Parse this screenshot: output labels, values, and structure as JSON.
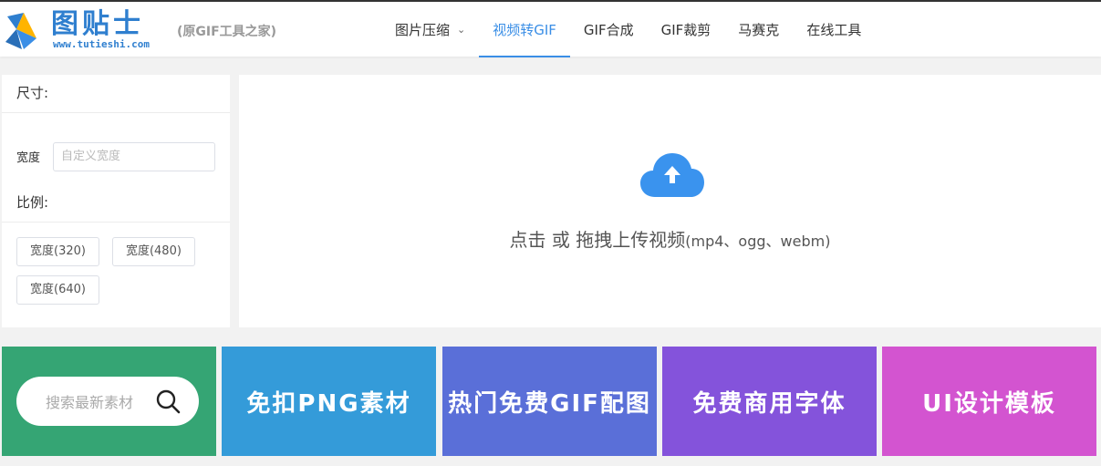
{
  "header": {
    "logo_name": "图贴士",
    "logo_url": "www.tutieshi.com",
    "logo_sub": "(原GIF工具之家)",
    "nav": [
      {
        "label": "图片压缩",
        "has_dropdown": true
      },
      {
        "label": "视频转GIF",
        "active": true
      },
      {
        "label": "GIF合成"
      },
      {
        "label": "GIF裁剪"
      },
      {
        "label": "马赛克"
      },
      {
        "label": "在线工具"
      }
    ]
  },
  "sidebar": {
    "size_heading": "尺寸:",
    "width_label": "宽度",
    "width_placeholder": "自定义宽度",
    "ratio_heading": "比例:",
    "ratio_buttons": [
      "宽度(320)",
      "宽度(480)",
      "宽度(640)"
    ]
  },
  "upload": {
    "text_main": "点击 或 拖拽上传视频",
    "text_formats": "(mp4、ogg、webm)",
    "icon": "cloud-upload-icon"
  },
  "tiles": {
    "search_placeholder": "搜索最新素材",
    "t2": "免扣PNG素材",
    "t3": "热门免费GIF配图",
    "t4": "免费商用字体",
    "t5": "UI设计模板"
  },
  "colors": {
    "accent": "#3a8ee6",
    "tile1": "#35a574",
    "tile2": "#349bd9",
    "tile3": "#5a6fd8",
    "tile4": "#8453db",
    "tile5": "#d354d0"
  }
}
